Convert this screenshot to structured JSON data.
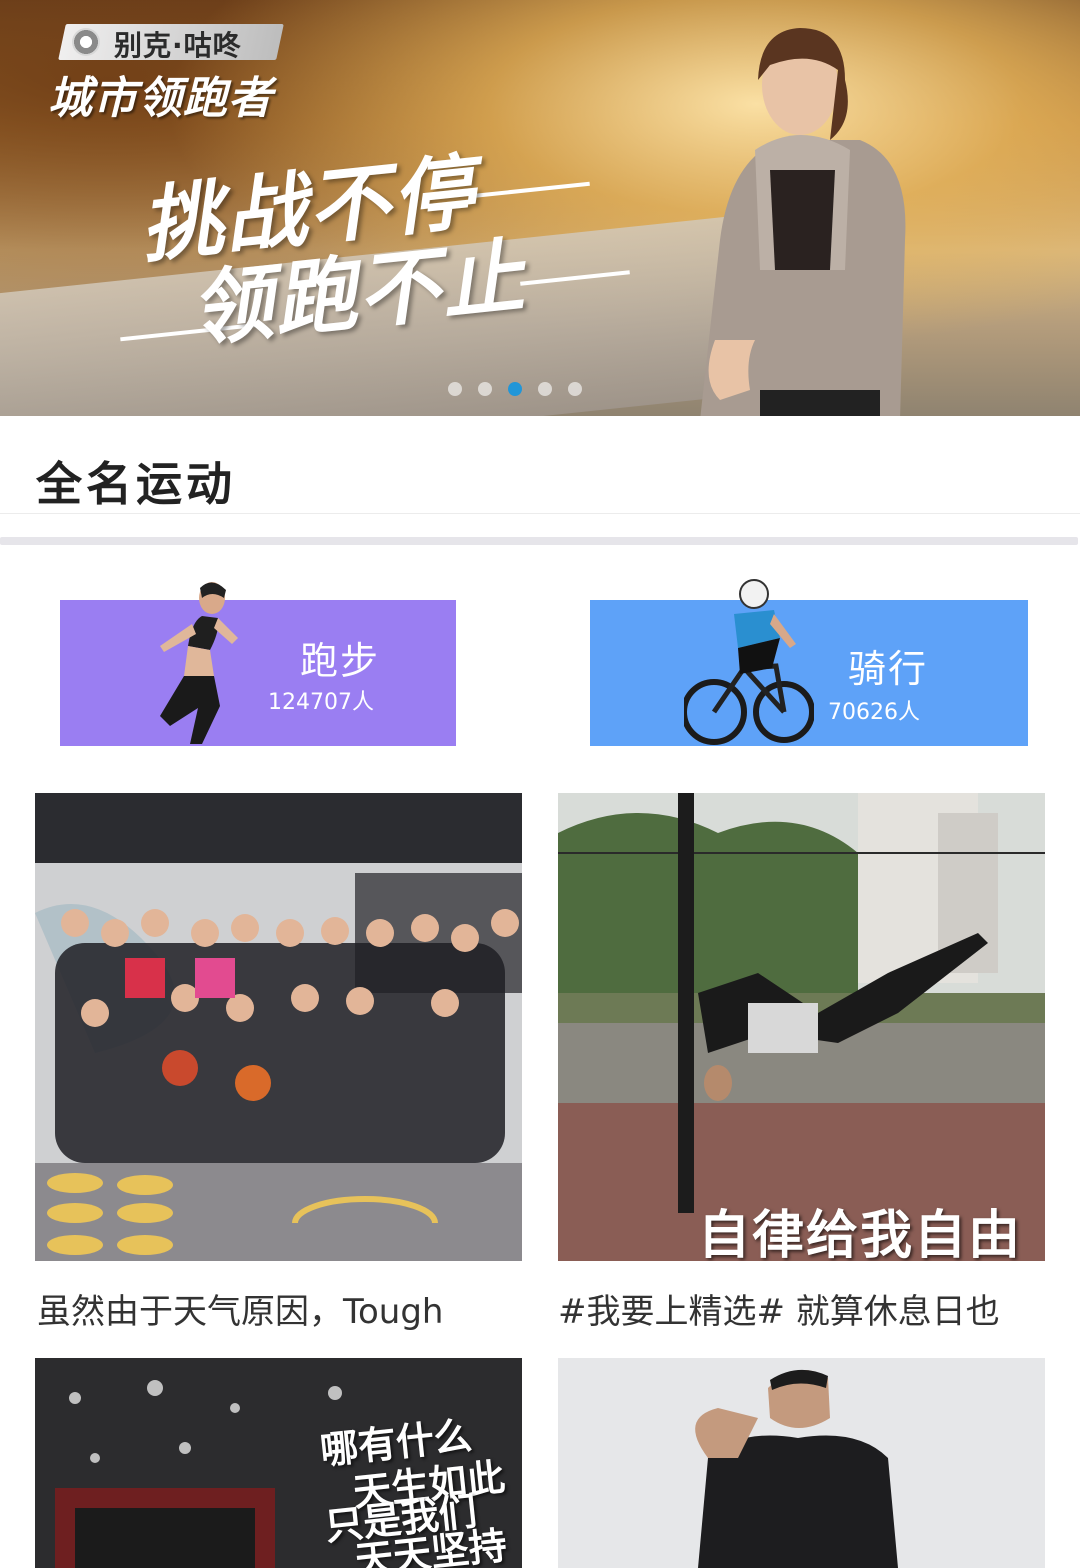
{
  "banner": {
    "brand": "别克·咕咚",
    "campaign": "城市领跑者",
    "slogan_line1": "挑战不停",
    "slogan_line2": "领跑不止",
    "dots_count": 5,
    "active_dot": 2,
    "accent_color": "#2196d8"
  },
  "section": {
    "title": "全名运动"
  },
  "categories": [
    {
      "label": "跑步",
      "count": "124707人",
      "color": "#9a7ef2",
      "icon": "runner-figure"
    },
    {
      "label": "骑行",
      "count": "70626人",
      "color": "#5ea2f8",
      "icon": "cyclist-figure"
    }
  ],
  "feed": [
    {
      "caption": "虽然由于天气原因，Tough",
      "image": "group-fitness-photo"
    },
    {
      "caption": "#我要上精选# 就算休息日也",
      "image": "pole-trick-photo",
      "overlay": "自律给我自由"
    },
    {
      "caption": "",
      "image": "gym-motivation-photo",
      "overlay_lines": [
        "哪有什么",
        "天生如此",
        "只是我们",
        "天天坚持"
      ]
    },
    {
      "caption": "",
      "image": "athlete-tshirt-photo"
    }
  ]
}
